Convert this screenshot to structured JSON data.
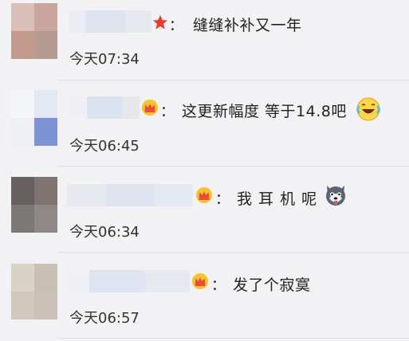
{
  "comments": [
    {
      "text": "缝缝补补又一年",
      "time": "今天07:34",
      "badge": "star-badge",
      "colon": "："
    },
    {
      "text": "这更新幅度 等于14.8吧",
      "time": "今天06:45",
      "badge": "crown-badge",
      "colon": "：",
      "emoji": "laughing-crying-emoji"
    },
    {
      "text": "我 耳 机 呢",
      "time": "今天06:34",
      "badge": "crown-badge",
      "colon": "：",
      "emoji": "husky-dog-emoji"
    },
    {
      "text": "发了个寂寞",
      "time": "今天06:57",
      "badge": "crown-badge",
      "colon": "："
    }
  ]
}
